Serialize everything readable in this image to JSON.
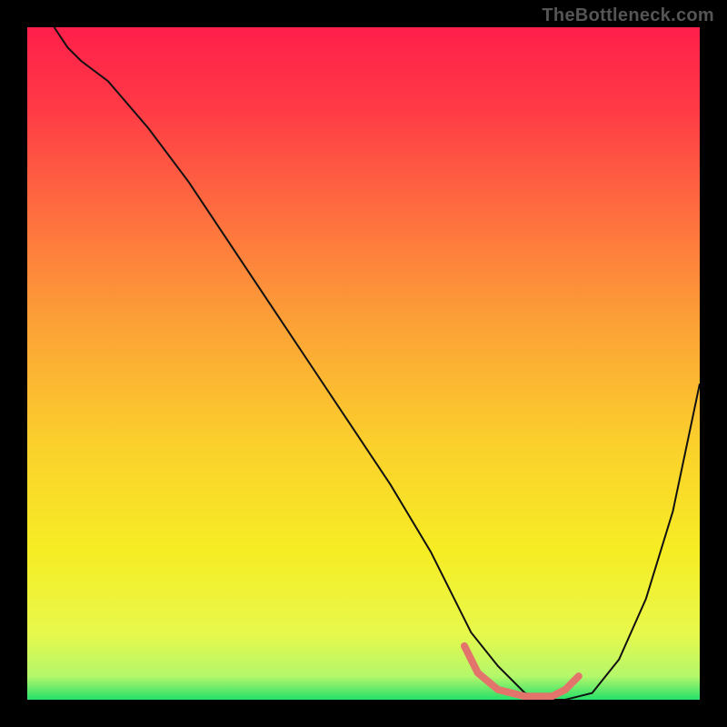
{
  "watermark": "TheBottleneck.com",
  "chart_data": {
    "type": "line",
    "title": "",
    "xlabel": "",
    "ylabel": "",
    "xlim": [
      0,
      100
    ],
    "ylim": [
      0,
      100
    ],
    "grid": false,
    "legend": false,
    "series": [
      {
        "name": "curve",
        "x": [
          4,
          6,
          8,
          12,
          18,
          24,
          30,
          36,
          42,
          48,
          54,
          60,
          63,
          66,
          70,
          74,
          77,
          80,
          84,
          88,
          92,
          96,
          100
        ],
        "y": [
          100,
          97,
          95,
          92,
          85,
          77,
          68,
          59,
          50,
          41,
          32,
          22,
          16,
          10,
          5,
          1,
          0,
          0,
          1,
          6,
          15,
          28,
          47
        ],
        "color": "#111111",
        "width": 2
      }
    ],
    "highlight": {
      "name": "trough-marker",
      "x": [
        65,
        67,
        70,
        74,
        78,
        80,
        82
      ],
      "y": [
        8,
        4,
        1.5,
        0.5,
        0.5,
        1.5,
        3.5
      ],
      "color": "#E2746B",
      "width": 8
    },
    "background_gradient": {
      "stops": [
        {
          "offset": 0.0,
          "color": "#FF1F4B"
        },
        {
          "offset": 0.12,
          "color": "#FF3A46"
        },
        {
          "offset": 0.28,
          "color": "#FE6F3F"
        },
        {
          "offset": 0.45,
          "color": "#FCA436"
        },
        {
          "offset": 0.62,
          "color": "#FBD02C"
        },
        {
          "offset": 0.78,
          "color": "#F6ED24"
        },
        {
          "offset": 0.9,
          "color": "#E8F84B"
        },
        {
          "offset": 0.965,
          "color": "#B4F76A"
        },
        {
          "offset": 1.0,
          "color": "#25E06A"
        }
      ]
    }
  }
}
